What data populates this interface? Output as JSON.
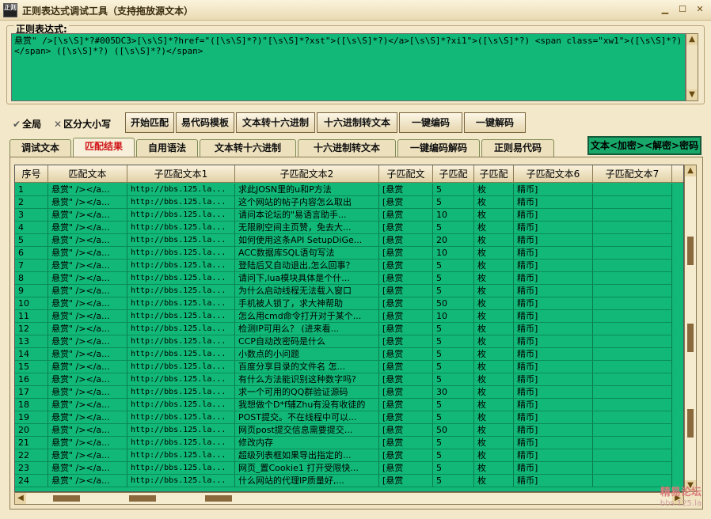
{
  "window": {
    "title": "正则表达式调试工具（支持拖放源文本）",
    "icon_text": "正则"
  },
  "regex": {
    "label": "正则表达式:",
    "value": "悬赏\" />[\\s\\S]*?#005DC3>[\\s\\S]*?href=\"([\\s\\S]*?)\"[\\s\\S]*?xst\">([\\s\\S]*?)</a>[\\s\\S]*?xi1\">([\\s\\S]*?) <span class=\"xw1\">([\\s\\S]*?)</span> ([\\s\\S]*?) ([\\s\\S]*?)</span>"
  },
  "options": {
    "global_label": "全局",
    "case_label": "区分大小写"
  },
  "toolbar": {
    "start_match": "开始匹配",
    "yi_template": "易代码模板",
    "text_to_hex": "文本转十六进制",
    "hex_to_text": "十六进制转文本",
    "one_encode": "一键编码",
    "one_decode": "一键解码"
  },
  "tabs": [
    {
      "label": "调试文本"
    },
    {
      "label": "匹配结果"
    },
    {
      "label": "自用语法"
    },
    {
      "label": "文本转十六进制"
    },
    {
      "label": "十六进制转文本"
    },
    {
      "label": "一键编码解码"
    },
    {
      "label": "正则易代码"
    }
  ],
  "crypto_button": "文本<加密><解密>密码",
  "table": {
    "columns": [
      "序号",
      "匹配文本",
      "子匹配文本1",
      "子匹配文本2",
      "子匹配文",
      "子匹配",
      "子匹配",
      "子匹配文本6",
      "子匹配文本7"
    ],
    "rows": [
      [
        "1",
        "悬赏\" /></a...",
        "http://bbs.125.la...",
        "求此JOSN里的u和P方法",
        "[悬赏",
        "5",
        "枚",
        "精币]",
        ""
      ],
      [
        "2",
        "悬赏\" /></a...",
        "http://bbs.125.la...",
        "这个网站的帖子内容怎么取出",
        "[悬赏",
        "5",
        "枚",
        "精币]",
        ""
      ],
      [
        "3",
        "悬赏\" /></a...",
        "http://bbs.125.la...",
        "请问本论坛的\"易语言助手...",
        "[悬赏",
        "10",
        "枚",
        "精币]",
        ""
      ],
      [
        "4",
        "悬赏\" /></a...",
        "http://bbs.125.la...",
        "无限刷空间主页赞，免去大...",
        "[悬赏",
        "5",
        "枚",
        "精币]",
        ""
      ],
      [
        "5",
        "悬赏\" /></a...",
        "http://bbs.125.la...",
        "如何使用这条API SetupDiGe...",
        "[悬赏",
        "20",
        "枚",
        "精币]",
        ""
      ],
      [
        "6",
        "悬赏\" /></a...",
        "http://bbs.125.la...",
        "ACC数据库SQL语句写法",
        "[悬赏",
        "10",
        "枚",
        "精币]",
        ""
      ],
      [
        "7",
        "悬赏\" /></a...",
        "http://bbs.125.la...",
        "登陆后又自动退出,怎么回事？",
        "[悬赏",
        "5",
        "枚",
        "精币]",
        ""
      ],
      [
        "8",
        "悬赏\" /></a...",
        "http://bbs.125.la...",
        "请问下,lua模块具体是个什...",
        "[悬赏",
        "5",
        "枚",
        "精币]",
        ""
      ],
      [
        "9",
        "悬赏\" /></a...",
        "http://bbs.125.la...",
        "为什么启动线程无法载入窗口",
        "[悬赏",
        "5",
        "枚",
        "精币]",
        ""
      ],
      [
        "10",
        "悬赏\" /></a...",
        "http://bbs.125.la...",
        "手机被人锁了，求大神帮助",
        "[悬赏",
        "50",
        "枚",
        "精币]",
        ""
      ],
      [
        "11",
        "悬赏\" /></a...",
        "http://bbs.125.la...",
        "怎么用cmd命令打开对于某个...",
        "[悬赏",
        "10",
        "枚",
        "精币]",
        ""
      ],
      [
        "12",
        "悬赏\" /></a...",
        "http://bbs.125.la...",
        "检测IP可用么？  (进来看...",
        "[悬赏",
        "5",
        "枚",
        "精币]",
        ""
      ],
      [
        "13",
        "悬赏\" /></a...",
        "http://bbs.125.la...",
        "CCP自动改密码是什么",
        "[悬赏",
        "5",
        "枚",
        "精币]",
        ""
      ],
      [
        "14",
        "悬赏\" /></a...",
        "http://bbs.125.la...",
        "小数点的小问题",
        "[悬赏",
        "5",
        "枚",
        "精币]",
        ""
      ],
      [
        "15",
        "悬赏\" /></a...",
        "http://bbs.125.la...",
        "百度分享目录的文件名  怎...",
        "[悬赏",
        "5",
        "枚",
        "精币]",
        ""
      ],
      [
        "16",
        "悬赏\" /></a...",
        "http://bbs.125.la...",
        "有什么方法能识别这种数字吗?",
        "[悬赏",
        "5",
        "枚",
        "精币]",
        ""
      ],
      [
        "17",
        "悬赏\" /></a...",
        "http://bbs.125.la...",
        "求一个可用的QQ群验证源码",
        "[悬赏",
        "30",
        "枚",
        "精币]",
        ""
      ],
      [
        "18",
        "悬赏\" /></a...",
        "http://bbs.125.la...",
        "我想做个D*f辅Zhu有没有收徒的",
        "[悬赏",
        "5",
        "枚",
        "精币]",
        ""
      ],
      [
        "19",
        "悬赏\" /></a...",
        "http://bbs.125.la...",
        "POST提交。不在线程中可以...",
        "[悬赏",
        "5",
        "枚",
        "精币]",
        ""
      ],
      [
        "20",
        "悬赏\" /></a...",
        "http://bbs.125.la...",
        "网页post提交信息需要提交...",
        "[悬赏",
        "50",
        "枚",
        "精币]",
        ""
      ],
      [
        "21",
        "悬赏\" /></a...",
        "http://bbs.125.la...",
        "修改内存",
        "[悬赏",
        "5",
        "枚",
        "精币]",
        ""
      ],
      [
        "22",
        "悬赏\" /></a...",
        "http://bbs.125.la...",
        "超级列表框如果导出指定的...",
        "[悬赏",
        "5",
        "枚",
        "精币]",
        ""
      ],
      [
        "23",
        "悬赏\" /></a...",
        "http://bbs.125.la...",
        "网页_置Cookie1 打开受限快...",
        "[悬赏",
        "5",
        "枚",
        "精币]",
        ""
      ],
      [
        "24",
        "悬赏\" /></a...",
        "http://bbs.125.la...",
        "什么网站的代理IP质量好,...",
        "[悬赏",
        "5",
        "枚",
        "精币]",
        ""
      ]
    ]
  },
  "watermark": {
    "name": "精易论坛",
    "url": "bbs.125.la"
  }
}
